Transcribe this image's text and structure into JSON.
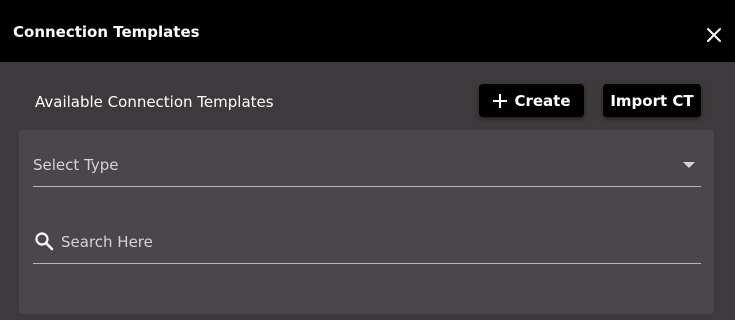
{
  "header": {
    "title": "Connection Templates"
  },
  "toolbar": {
    "section_label": "Available Connection Templates",
    "create_label": "Create",
    "import_label": "Import CT"
  },
  "filters": {
    "type_select_placeholder": "Select Type",
    "search_placeholder": "Search Here"
  },
  "icons": {
    "close": "close-icon",
    "create": "plus-icon",
    "search": "search-icon",
    "select": "chevron-down-icon"
  },
  "colors": {
    "header_bg": "#000000",
    "body_bg": "#3d393c",
    "panel_bg": "#4a464b",
    "button_bg": "#000000",
    "text": "#ffffff",
    "muted_text": "#d6d2d5"
  }
}
